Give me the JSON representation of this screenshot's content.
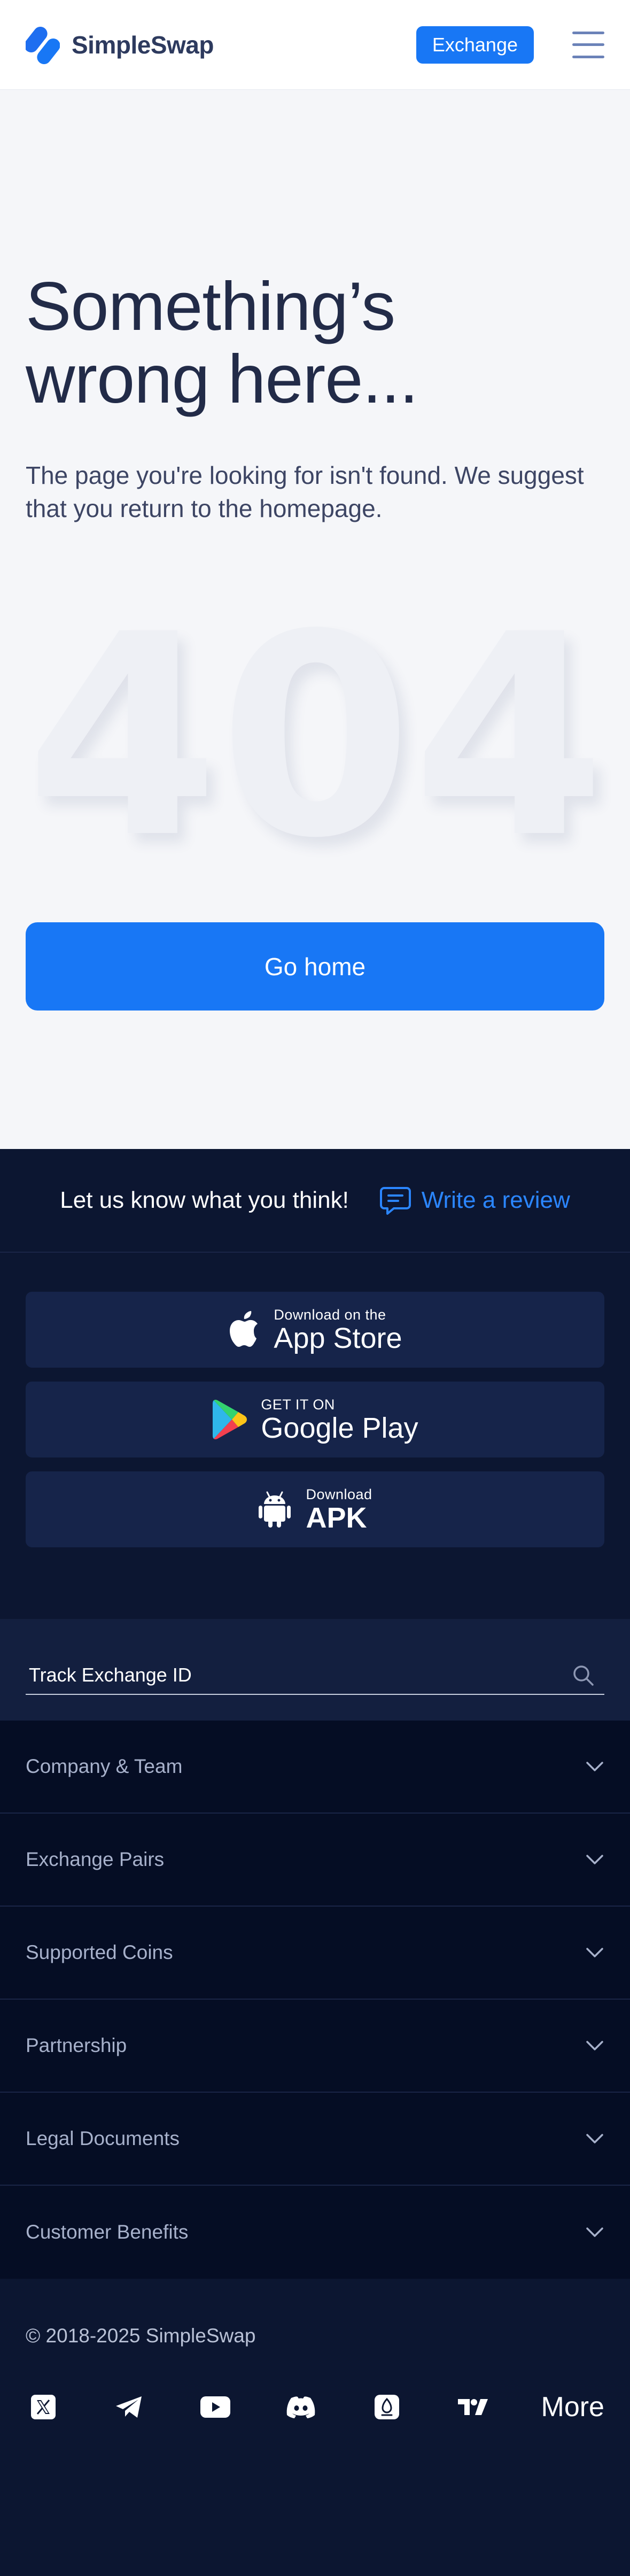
{
  "header": {
    "logo_text": "SimpleSwap",
    "exchange_label": "Exchange"
  },
  "main": {
    "title": "Something’s wrong here...",
    "subtitle": "The page you're looking for isn't found. We suggest that you return to the homepage.",
    "error_code": [
      "4",
      "0",
      "4"
    ],
    "go_home_label": "Go home"
  },
  "footer": {
    "review_prompt": "Let us know what you think!",
    "review_link": "Write a review",
    "stores": {
      "app_store": {
        "small": "Download on the",
        "big": "App Store"
      },
      "google_play": {
        "small": "GET IT ON",
        "big": "Google Play"
      },
      "apk": {
        "small": "Download",
        "big": "APK"
      }
    },
    "track_label": "Track Exchange ID",
    "accordion": [
      {
        "label": "Company & Team"
      },
      {
        "label": "Exchange Pairs"
      },
      {
        "label": "Supported Coins"
      },
      {
        "label": "Partnership"
      },
      {
        "label": "Legal Documents"
      },
      {
        "label": "Customer Benefits"
      }
    ],
    "copyright": "© 2018-2025 SimpleSwap",
    "social_icons": [
      "x-icon",
      "telegram-icon",
      "youtube-icon",
      "discord-icon",
      "coinmarketcap-icon",
      "tradingview-icon"
    ],
    "more_label": "More"
  },
  "colors": {
    "accent": "#1877f5",
    "footer_bg": "#0c1631",
    "accordion_bg": "#050d24",
    "main_bg": "#f5f6f9"
  }
}
